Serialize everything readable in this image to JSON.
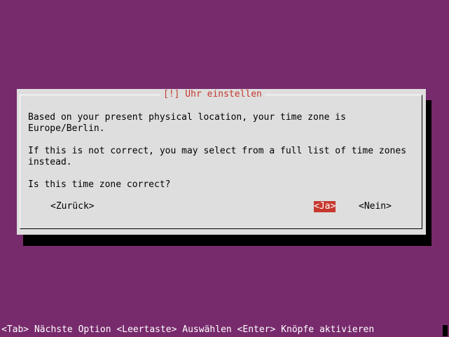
{
  "dialog": {
    "title": "[!] Uhr einstellen",
    "lines": [
      "Based on your present physical location, your time zone is",
      "Europe/Berlin.",
      "If this is not correct, you may select from a full list of time zones",
      "instead.",
      "Is this time zone correct?"
    ],
    "buttons": {
      "back": "<Zurück>",
      "yes": "<Ja>",
      "no": "<Nein>"
    }
  },
  "statusbar": {
    "text": "<Tab> Nächste Option <Leertaste> Auswählen <Enter> Knöpfe aktivieren"
  },
  "colors": {
    "background": "#772a6c",
    "dialog": "#dedede",
    "accent": "#c6382e"
  }
}
